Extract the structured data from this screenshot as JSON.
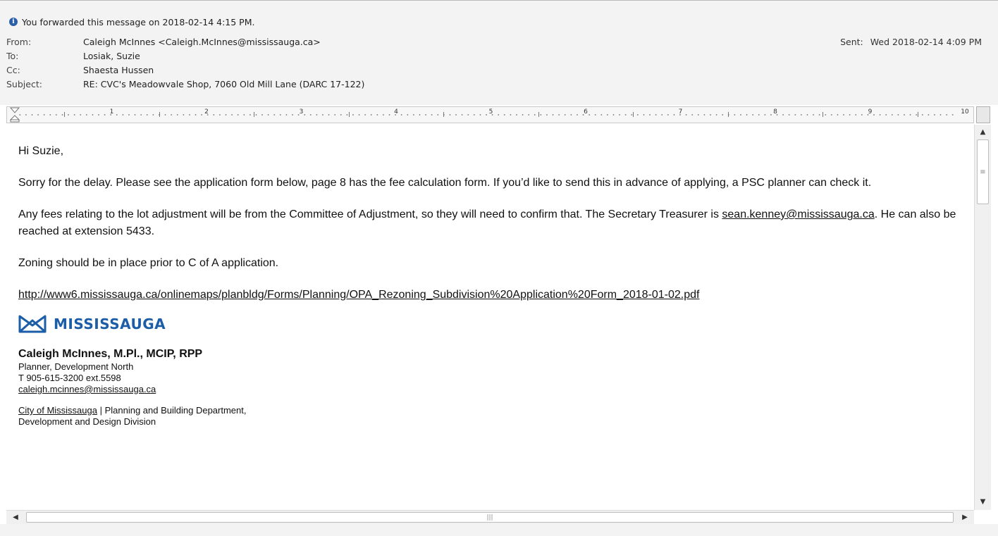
{
  "infobar": {
    "icon": "info-icon",
    "text": "You forwarded this message on 2018-02-14 4:15 PM."
  },
  "header": {
    "from_label": "From:",
    "from_value": "Caleigh McInnes <Caleigh.McInnes@mississauga.ca>",
    "to_label": "To:",
    "to_value": "Losiak, Suzie",
    "cc_label": "Cc:",
    "cc_value": "Shaesta Hussen",
    "subject_label": "Subject:",
    "subject_value": "RE: CVC's Meadowvale Shop, 7060 Old Mill Lane (DARC 17-122)",
    "sent_label": "Sent:",
    "sent_value": "Wed 2018-02-14 4:09 PM"
  },
  "ruler": {
    "numbers": [
      "1",
      "2",
      "3",
      "4",
      "5",
      "6",
      "7",
      "8",
      "9",
      "10"
    ]
  },
  "message": {
    "greeting": "Hi Suzie,",
    "para1": "Sorry for the delay. Please see the application form below, page 8 has the fee calculation form. If you’d like to send this in advance of applying, a PSC planner can check it.",
    "para2_before": "Any fees relating to the lot adjustment will be from the Committee of Adjustment, so they will need to confirm that. The Secretary Treasurer is ",
    "para2_link": "sean.kenney@mississauga.ca",
    "para2_after": ". He can also be reached at extension 5433.",
    "para3": "Zoning should be in place prior to C of A application.",
    "url": "http://www6.mississauga.ca/onlinemaps/planbldg/Forms/Planning/OPA_Rezoning_Subdivision%20Application%20Form_2018-01-02.pdf"
  },
  "signature": {
    "logo_text": "MISSISSAUGA",
    "name": "Caleigh McInnes, M.Pl., MCIP, RPP",
    "title": "Planner, Development North",
    "phone": "T 905-615-3200 ext.5598",
    "email": "caleigh.mcinnes@mississauga.ca",
    "org_link": "City of Mississauga",
    "org_rest": " | Planning and Building Department,",
    "division": "Development and Design Division"
  },
  "colors": {
    "brand_blue": "#1b5ea7",
    "link_blue": "#1a3bd6",
    "header_bg": "#f3f3f3"
  }
}
